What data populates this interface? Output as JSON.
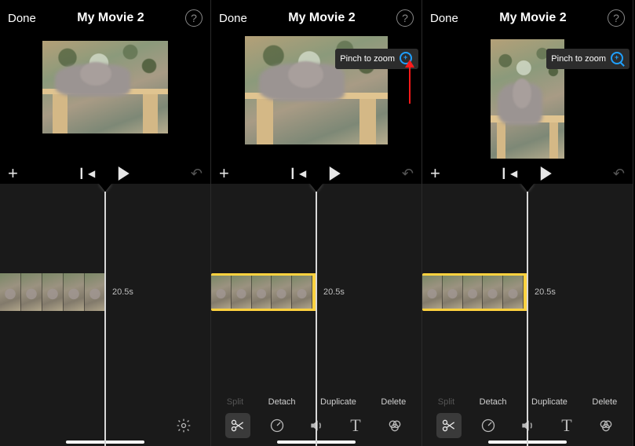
{
  "screens": [
    {
      "header": {
        "done": "Done",
        "title": "My Movie 2",
        "help": "?"
      },
      "preview": {
        "variant": "wide",
        "pinch_visible": false,
        "arrow_visible": false
      },
      "transport": {
        "add": "+",
        "undo": "↶"
      },
      "clip": {
        "selected": false,
        "duration": "20.5s"
      },
      "edit_actions_visible": false,
      "toolbar_mode": "single"
    },
    {
      "header": {
        "done": "Done",
        "title": "My Movie 2",
        "help": "?"
      },
      "preview": {
        "variant": "mid",
        "pinch_visible": true,
        "arrow_visible": true,
        "pinch_label": "Pinch to zoom"
      },
      "transport": {
        "add": "+",
        "undo": "↶"
      },
      "clip": {
        "selected": true,
        "duration": "20.5s"
      },
      "edit_actions_visible": true,
      "edit_actions": {
        "split": "Split",
        "detach": "Detach",
        "duplicate": "Duplicate",
        "delete": "Delete"
      },
      "toolbar_mode": "full"
    },
    {
      "header": {
        "done": "Done",
        "title": "My Movie 2",
        "help": "?"
      },
      "preview": {
        "variant": "tall",
        "pinch_visible": true,
        "arrow_visible": false,
        "pinch_label": "Pinch to zoom"
      },
      "transport": {
        "add": "+",
        "undo": "↶"
      },
      "clip": {
        "selected": true,
        "duration": "20.5s"
      },
      "edit_actions_visible": true,
      "edit_actions": {
        "split": "Split",
        "detach": "Detach",
        "duplicate": "Duplicate",
        "delete": "Delete"
      },
      "toolbar_mode": "full"
    }
  ]
}
